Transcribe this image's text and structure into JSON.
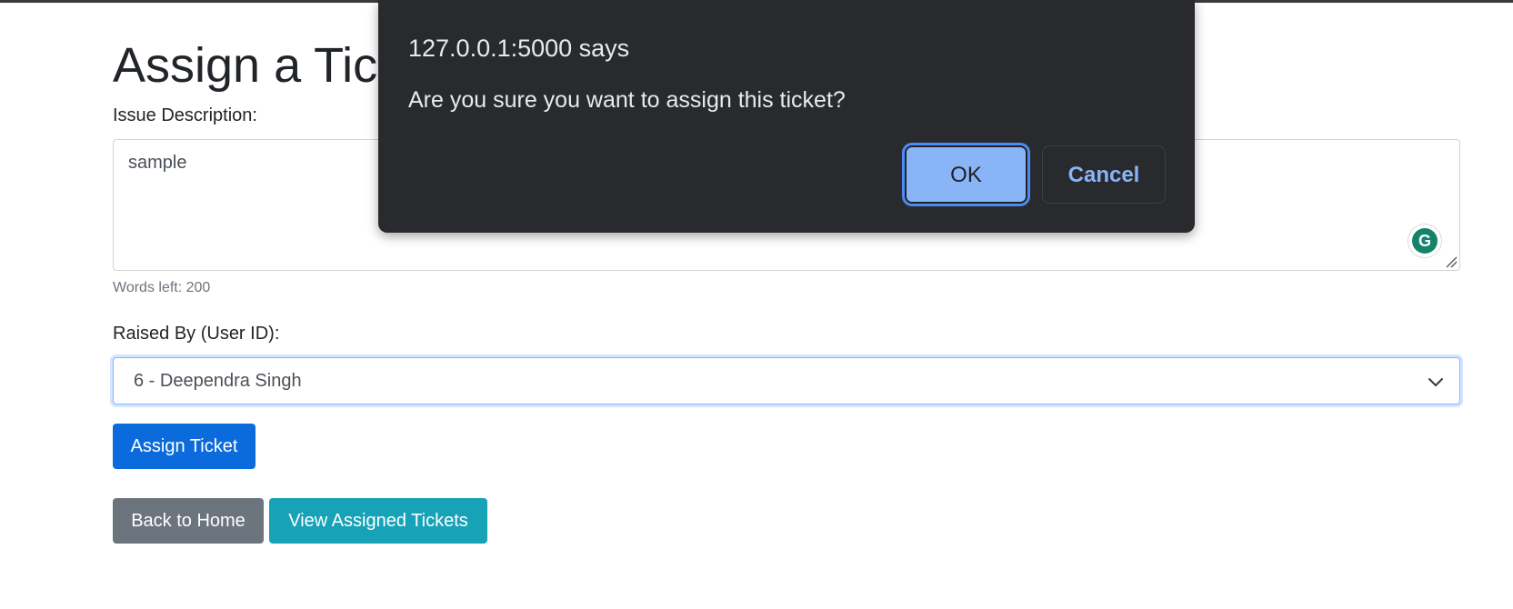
{
  "page": {
    "title": "Assign a Ticket"
  },
  "form": {
    "issue_description_label": "Issue Description:",
    "issue_description_value": "sample",
    "words_left": "Words left: 200",
    "raised_by_label": "Raised By (User ID):",
    "raised_by_selected": "6 - Deependra Singh",
    "assign_button": "Assign Ticket"
  },
  "nav": {
    "back_home_button": "Back to Home",
    "view_assigned_button": "View Assigned Tickets"
  },
  "dialog": {
    "title": "127.0.0.1:5000 says",
    "message": "Are you sure you want to assign this ticket?",
    "ok_label": "OK",
    "cancel_label": "Cancel"
  },
  "icons": {
    "grammarly": "grammarly-icon",
    "resize": "resize-handle-icon",
    "select_chevron": "chevron-down-icon"
  },
  "colors": {
    "primary": "#0b6bdc",
    "secondary": "#6c757d",
    "info": "#17a2b8",
    "dialog_bg": "#292a2d",
    "dialog_accent": "#8ab4f8"
  }
}
